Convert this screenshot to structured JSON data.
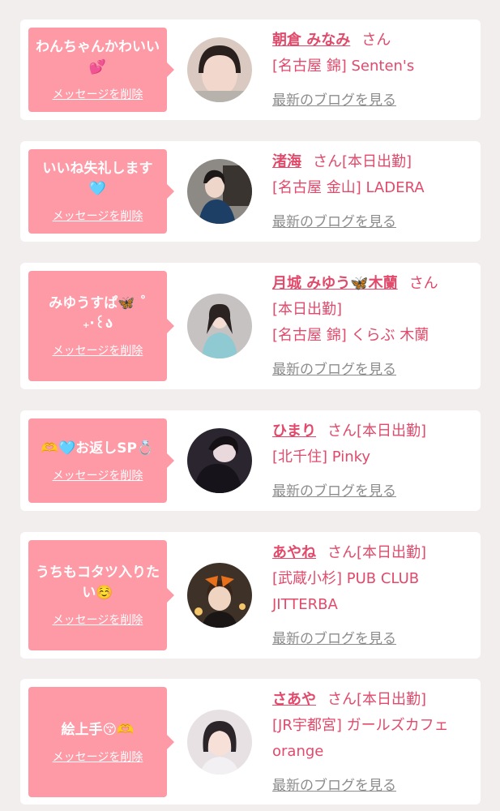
{
  "messages": [
    {
      "message": "わんちゃんかわいい💕",
      "delete_label": "メッセージを削除",
      "name": "朝倉 みなみ",
      "honorific": "さん",
      "status": "",
      "shop": "[名古屋 錦] Senten's",
      "blog_link": "最新のブログを見る",
      "avatar_icon": "profile-photo"
    },
    {
      "message": "いいね失礼します🩵",
      "delete_label": "メッセージを削除",
      "name": "渚海",
      "honorific": "さん",
      "status": "[本日出勤]",
      "shop": "[名古屋 金山] LADERA",
      "blog_link": "最新のブログを見る",
      "avatar_icon": "profile-photo"
    },
    {
      "message": "みゆうすぱ🦋 ˚₊‧꒰ა",
      "delete_label": "メッセージを削除",
      "name": "月城 みゆう🦋木蘭",
      "honorific": "さん",
      "status": "[本日出勤]",
      "shop": "[名古屋 錦] くらぶ 木蘭",
      "blog_link": "最新のブログを見る",
      "avatar_icon": "profile-photo"
    },
    {
      "message": "🫶🩵お返しSP💍",
      "delete_label": "メッセージを削除",
      "name": "ひまり",
      "honorific": "さん",
      "status": "[本日出勤]",
      "shop": "[北千住] Pinky",
      "blog_link": "最新のブログを見る",
      "avatar_icon": "profile-photo"
    },
    {
      "message": "うちもコタツ入りたい☺️",
      "delete_label": "メッセージを削除",
      "name": "あやね",
      "honorific": "さん",
      "status": "[本日出勤]",
      "shop": "[武蔵小杉] PUB CLUB JITTERBA",
      "blog_link": "最新のブログを見る",
      "avatar_icon": "profile-photo"
    },
    {
      "message": "絵上手😚🫶",
      "delete_label": "メッセージを削除",
      "name": "さあや",
      "honorific": "さん",
      "status": "[本日出勤]",
      "shop": "[JR宇都宮] ガールズカフェ orange",
      "blog_link": "最新のブログを見る",
      "avatar_icon": "profile-photo"
    }
  ],
  "colors": {
    "page_bg": "#f3eeee",
    "bubble": "#fe99a6",
    "accent_text": "#e14a6b",
    "link_gray": "#8c8c8c"
  }
}
